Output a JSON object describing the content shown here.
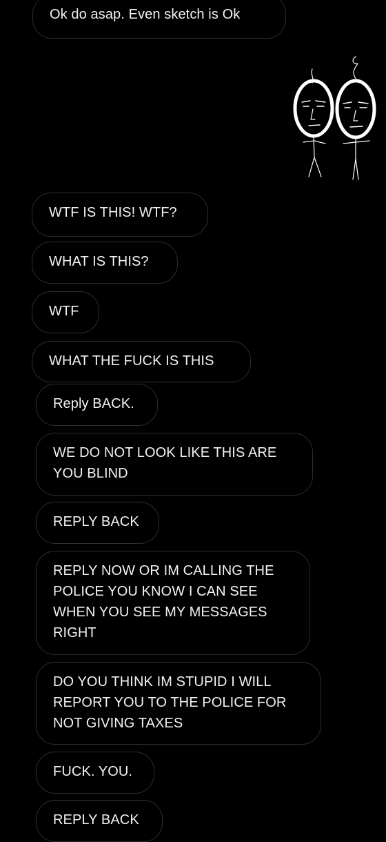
{
  "chat": {
    "messages": [
      {
        "text": "Ok do asap. Even sketch is Ok"
      },
      {
        "sticker": "two-faces-doodle-sticker"
      },
      {
        "text": "WTF IS THIS! WTF?"
      },
      {
        "text": "WHAT IS THIS?"
      },
      {
        "text": "WTF"
      },
      {
        "text": "WHAT THE FUCK IS THIS"
      },
      {
        "text": "Reply BACK."
      },
      {
        "text": "WE DO NOT LOOK LIKE THIS ARE YOU BLIND"
      },
      {
        "text": "REPLY BACK"
      },
      {
        "text": "REPLY NOW OR IM CALLING THE POLICE YOU KNOW I CAN SEE WHEN YOU SEE MY MESSAGES RIGHT"
      },
      {
        "text": "DO YOU THINK IM STUPID I WILL REPORT YOU TO THE POLICE FOR NOT GIVING TAXES"
      },
      {
        "text": "FUCK. YOU."
      },
      {
        "text": "REPLY BACK"
      }
    ]
  },
  "colors": {
    "background": "#000000",
    "bubble_border": "#2e2e2e",
    "text": "#f2f2f2"
  }
}
